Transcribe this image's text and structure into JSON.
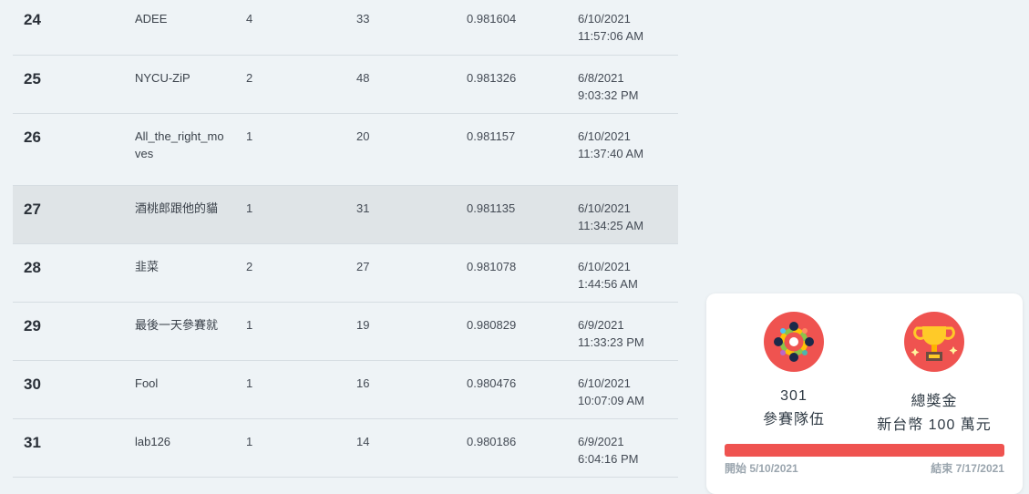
{
  "leaderboard": {
    "rows": [
      {
        "rank": "24",
        "team": "ADEE",
        "members": "4",
        "entries": "33",
        "score": "0.981604",
        "date": "6/10/2021",
        "time": "11:57:06 AM"
      },
      {
        "rank": "25",
        "team": "NYCU-ZiP",
        "members": "2",
        "entries": "48",
        "score": "0.981326",
        "date": "6/8/2021",
        "time": "9:03:32 PM"
      },
      {
        "rank": "26",
        "team": "All_the_right_moves",
        "members": "1",
        "entries": "20",
        "score": "0.981157",
        "date": "6/10/2021",
        "time": "11:37:40 AM"
      },
      {
        "rank": "27",
        "team": "酒桃郎跟他的貓",
        "members": "1",
        "entries": "31",
        "score": "0.981135",
        "date": "6/10/2021",
        "time": "11:34:25 AM"
      },
      {
        "rank": "28",
        "team": "韭菜",
        "members": "2",
        "entries": "27",
        "score": "0.981078",
        "date": "6/10/2021",
        "time": "1:44:56 AM"
      },
      {
        "rank": "29",
        "team": "最後一天參賽就",
        "members": "1",
        "entries": "19",
        "score": "0.980829",
        "date": "6/9/2021",
        "time": "11:33:23 PM"
      },
      {
        "rank": "30",
        "team": "Fool",
        "members": "1",
        "entries": "16",
        "score": "0.980476",
        "date": "6/10/2021",
        "time": "10:07:09 AM"
      },
      {
        "rank": "31",
        "team": "lab126",
        "members": "1",
        "entries": "14",
        "score": "0.980186",
        "date": "6/9/2021",
        "time": "6:04:16 PM"
      }
    ]
  },
  "summary": {
    "teams_count": "301",
    "teams_label": "參賽隊伍",
    "prize_title": "總獎金",
    "prize_amount": "新台幣 100 萬元",
    "teams_icon": "team-circle-icon",
    "prize_icon": "trophy-icon",
    "start_label": "開始 5/10/2021",
    "end_label": "結束 7/17/2021",
    "progress_fraction": 1.0,
    "accent_color": "#ef5350"
  }
}
